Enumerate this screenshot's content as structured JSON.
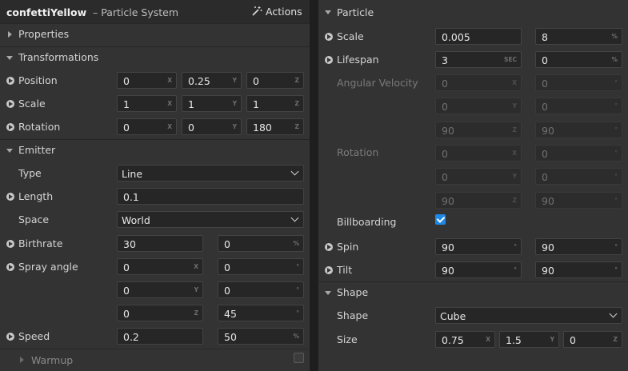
{
  "header": {
    "object_name": "confettiYellow",
    "object_type": "– Particle System",
    "actions_label": "Actions",
    "actions_icon": "magic-wand-icon"
  },
  "left": {
    "properties": {
      "title": "Properties"
    },
    "transformations": {
      "title": "Transformations",
      "position": {
        "label": "Position",
        "x": "0",
        "y": "0.25",
        "z": "0"
      },
      "scale": {
        "label": "Scale",
        "x": "1",
        "y": "1",
        "z": "1"
      },
      "rotation": {
        "label": "Rotation",
        "x": "0",
        "y": "0",
        "z": "180"
      }
    },
    "emitter": {
      "title": "Emitter",
      "type": {
        "label": "Type",
        "value": "Line"
      },
      "length": {
        "label": "Length",
        "value": "0.1"
      },
      "space": {
        "label": "Space",
        "value": "World"
      },
      "birthrate": {
        "label": "Birthrate",
        "value": "30",
        "variation": "0"
      },
      "spray_angle": {
        "label": "Spray angle",
        "x": "0",
        "x_var": "0",
        "y": "0",
        "y_var": "0",
        "z": "0",
        "z_var": "45"
      },
      "speed": {
        "label": "Speed",
        "value": "0.2",
        "variation": "50"
      },
      "warmup": {
        "label": "Warmup",
        "checked": false
      }
    }
  },
  "right": {
    "particle": {
      "title": "Particle",
      "scale": {
        "label": "Scale",
        "value": "0.005",
        "variation": "8"
      },
      "lifespan": {
        "label": "Lifespan",
        "value": "3",
        "variation": "0"
      },
      "angular_velocity": {
        "label": "Angular Velocity",
        "x": "0",
        "x_var": "0",
        "y": "0",
        "y_var": "0",
        "z": "90",
        "z_var": "90"
      },
      "rotation": {
        "label": "Rotation",
        "x": "0",
        "x_var": "0",
        "y": "0",
        "y_var": "0",
        "z": "90",
        "z_var": "90"
      },
      "billboarding": {
        "label": "Billboarding",
        "checked": true
      },
      "spin": {
        "label": "Spin",
        "value": "90",
        "variation": "90"
      },
      "tilt": {
        "label": "Tilt",
        "value": "90",
        "variation": "90"
      }
    },
    "shape": {
      "title": "Shape",
      "shape": {
        "label": "Shape",
        "value": "Cube"
      },
      "size": {
        "label": "Size",
        "x": "0.75",
        "y": "1.5",
        "z": "0"
      }
    }
  },
  "units": {
    "x": "X",
    "y": "Y",
    "z": "Z",
    "deg": "°",
    "pct": "%",
    "sec": "SEC"
  },
  "colors": {
    "panel_bg": "#333333",
    "field_bg": "#262626",
    "header_bg": "#2b2b2b",
    "accent": "#1e88e5"
  }
}
